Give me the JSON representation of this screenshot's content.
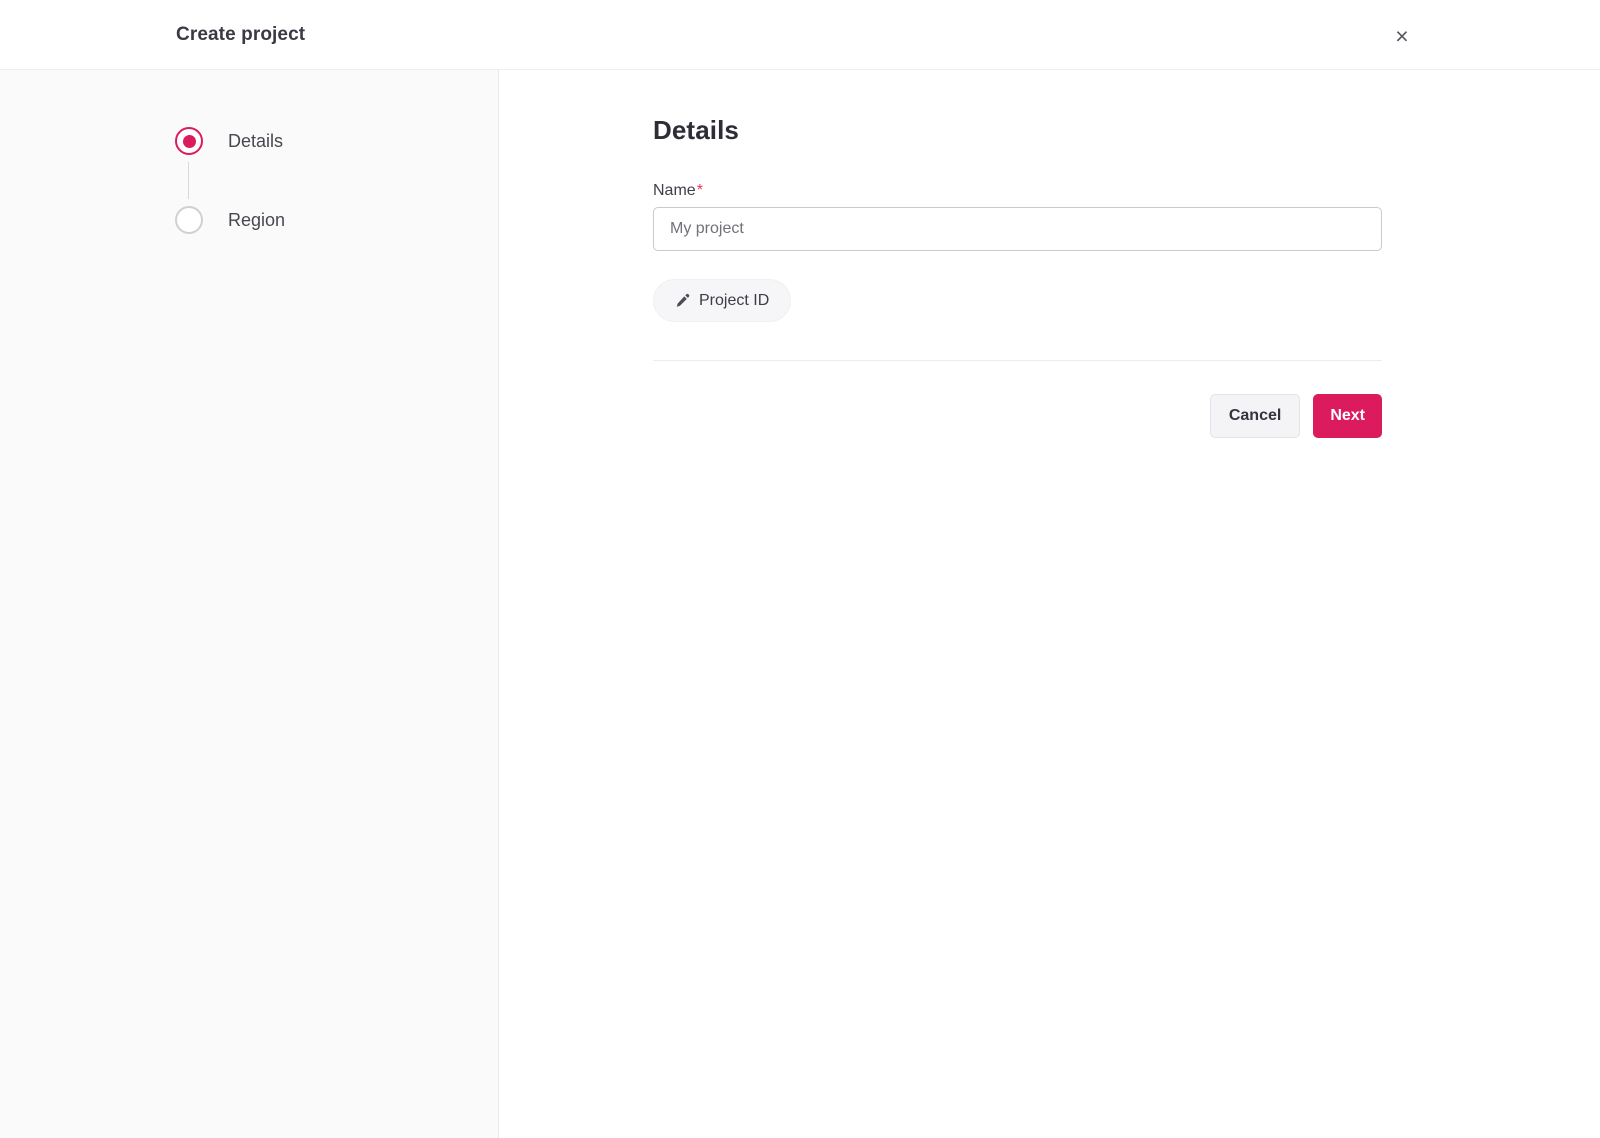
{
  "header": {
    "title": "Create project",
    "close_glyph": "×"
  },
  "stepper": {
    "steps": [
      {
        "label": "Details",
        "state": "active"
      },
      {
        "label": "Region",
        "state": "inactive"
      }
    ]
  },
  "main": {
    "heading": "Details",
    "name_field": {
      "label": "Name",
      "required_marker": "*",
      "value": "My project"
    },
    "project_id_button": {
      "label": "Project ID",
      "icon": "pencil-icon"
    },
    "footer": {
      "cancel_label": "Cancel",
      "next_label": "Next"
    }
  },
  "colors": {
    "accent": "#dc1b5e",
    "required_marker": "#e8385d"
  }
}
